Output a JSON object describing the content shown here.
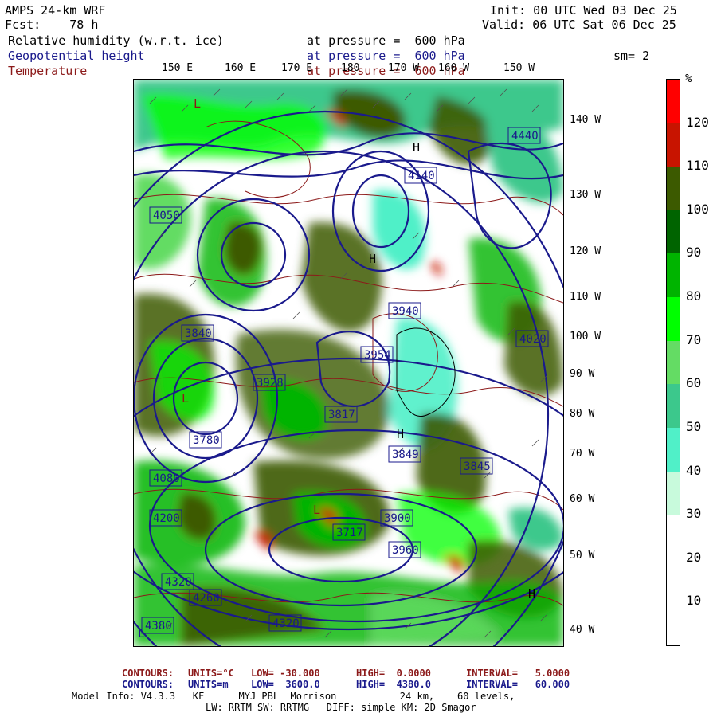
{
  "header": {
    "model": "AMPS 24-km WRF",
    "fcst": "Fcst:    78 h",
    "init": "Init: 00 UTC Wed 03 Dec 25",
    "valid": "Valid: 06 UTC Sat 06 Dec 25",
    "smoothing": "sm= 2"
  },
  "fields": [
    {
      "name": "Relative humidity (w.r.t. ice)",
      "level": "at pressure =  600 hPa",
      "color": "#000000"
    },
    {
      "name": "Geopotential height",
      "level": "at pressure =  600 hPa",
      "color": "#1a1a8c"
    },
    {
      "name": "Temperature",
      "level": "at pressure =  600 hPa",
      "color": "#8c1a1a"
    }
  ],
  "map": {
    "lon_labels": [
      "150 E",
      "160 E",
      "170 E",
      "180",
      "170 W",
      "160 W",
      "150 W"
    ],
    "lat_labels": [
      "140 W",
      "130 W",
      "120 W",
      "110 W",
      "100 W",
      "90 W",
      "80 W",
      "70 W",
      "60 W",
      "50 W",
      "40 W"
    ],
    "height_labels": [
      "4380",
      "4320",
      "4320",
      "4200",
      "4140",
      "4080",
      "4020",
      "3960",
      "3900",
      "3840",
      "3780",
      "3717",
      "3817",
      "3954",
      "3928",
      "3849",
      "3845",
      "3940",
      "4260",
      "4440",
      "4050"
    ],
    "low_high_marks": [
      "L",
      "H",
      "L",
      "H",
      "L",
      "H",
      "L",
      "H"
    ]
  },
  "colorbar": {
    "unit": "%",
    "labels": [
      "120",
      "110",
      "100",
      "90",
      "80",
      "70",
      "60",
      "50",
      "40",
      "30",
      "20",
      "10"
    ],
    "colors": [
      "#ff0000",
      "#c81400",
      "#3c5a00",
      "#006400",
      "#00b400",
      "#00ff00",
      "#64dc64",
      "#3cc88c",
      "#50f0c8",
      "#c8fadc",
      "#ffffff",
      "#ffffff",
      "#ffffff"
    ]
  },
  "footer": {
    "temp_contours": {
      "label": "CONTOURS:",
      "units": "UNITS=°C",
      "low": "LOW= -30.000",
      "high": "HIGH=  0.0000",
      "interval": "INTERVAL=   5.0000"
    },
    "height_contours": {
      "label": "CONTOURS:",
      "units": "UNITS=m",
      "low": "LOW=  3600.0",
      "high": "HIGH=  4380.0",
      "interval": "INTERVAL=   60.000"
    },
    "model_info": "Model Info: V4.3.3   KF      MYJ PBL  Morrison           24 km,    60 levels,",
    "physics": "LW: RRTM SW: RRTMG   DIFF: simple KM: 2D Smagor"
  }
}
